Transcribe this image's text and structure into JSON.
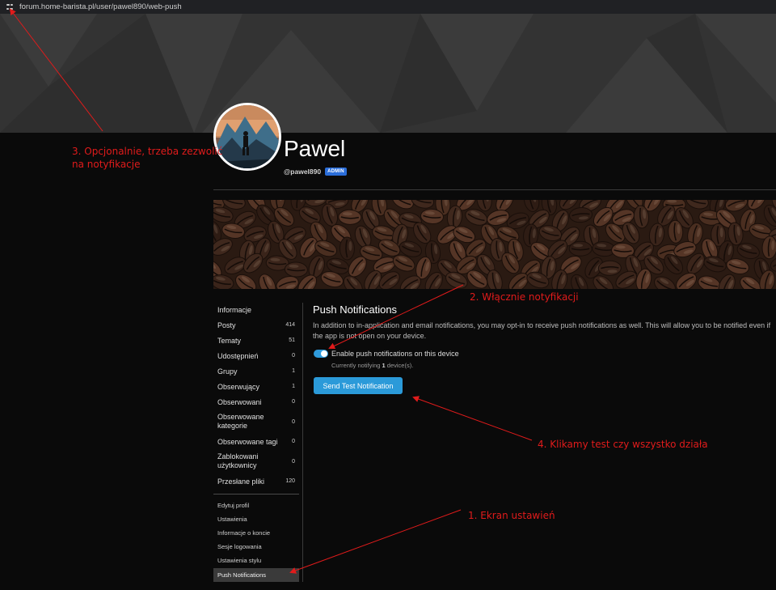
{
  "browser": {
    "url": "forum.home-barista.pl/user/pawel890/web-push",
    "site_icon": "site-settings-icon"
  },
  "profile": {
    "name": "Pawel",
    "handle": "@pawel890",
    "badge": "ADMIN"
  },
  "sidebar": {
    "items": [
      {
        "label": "Informacje",
        "count": ""
      },
      {
        "label": "Posty",
        "count": "414"
      },
      {
        "label": "Tematy",
        "count": "51"
      },
      {
        "label": "Udostępnień",
        "count": "0"
      },
      {
        "label": "Grupy",
        "count": "1"
      },
      {
        "label": "Obserwujący",
        "count": "1"
      },
      {
        "label": "Obserwowani",
        "count": "0"
      },
      {
        "label": "Obserwowane kategorie",
        "count": "0"
      },
      {
        "label": "Obserwowane tagi",
        "count": "0"
      },
      {
        "label": "Zablokowani użytkownicy",
        "count": "0"
      },
      {
        "label": "Przesłane pliki",
        "count": "120"
      }
    ],
    "settings": [
      {
        "label": "Edytuj profil"
      },
      {
        "label": "Ustawienia"
      },
      {
        "label": "Informacje o koncie"
      },
      {
        "label": "Sesje logowania"
      },
      {
        "label": "Ustawienia stylu"
      },
      {
        "label": "Push Notifications",
        "active": true
      }
    ]
  },
  "main": {
    "title": "Push Notifications",
    "description": "In addition to in-application and email notifications, you may opt-in to receive push notifications as well. This will allow you to be notified even if the app is not open on your device.",
    "toggle_label": "Enable push notifications on this device",
    "toggle_on": true,
    "notify_prefix": "Currently notifying ",
    "notify_count": "1",
    "notify_suffix": " device(s).",
    "test_button": "Send Test Notification"
  },
  "annotations": {
    "a1": "1. Ekran ustawień",
    "a2": "2. Włącznie notyfikacji",
    "a3_line1": "3. Opcjonalnie, trzeba zezwolić",
    "a3_line2": "na notyfikacje",
    "a4": "4. Klikamy test czy wszystko działa"
  },
  "colors": {
    "accent": "#2b9ad9",
    "annotation": "#e01b1b",
    "badge": "#2a6dd9"
  }
}
